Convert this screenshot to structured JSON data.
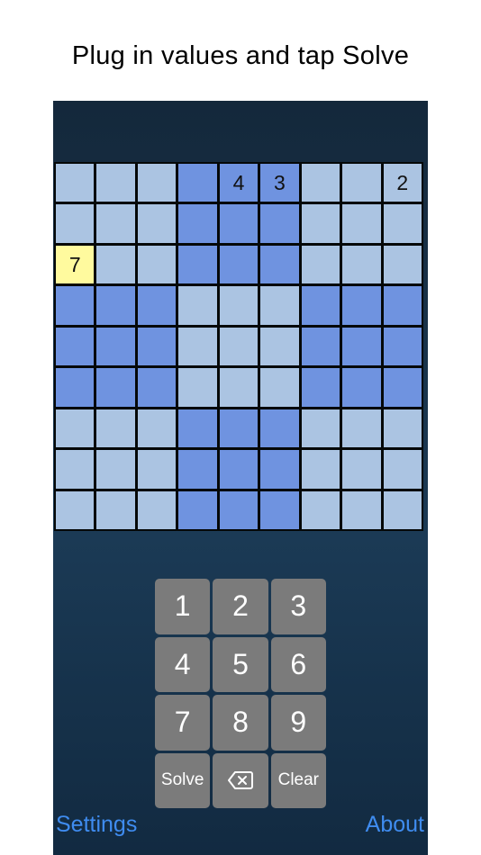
{
  "caption": "Plug in values and tap Solve",
  "grid": {
    "rows": [
      [
        "",
        "",
        "",
        "",
        "4",
        "3",
        "",
        "",
        "2"
      ],
      [
        "",
        "",
        "",
        "",
        "",
        "",
        "",
        "",
        ""
      ],
      [
        "7",
        "",
        "",
        "",
        "",
        "",
        "",
        "",
        ""
      ],
      [
        "",
        "",
        "",
        "",
        "",
        "",
        "",
        "",
        ""
      ],
      [
        "",
        "",
        "",
        "",
        "",
        "",
        "",
        "",
        ""
      ],
      [
        "",
        "",
        "",
        "",
        "",
        "",
        "",
        "",
        ""
      ],
      [
        "",
        "",
        "",
        "",
        "",
        "",
        "",
        "",
        ""
      ],
      [
        "",
        "",
        "",
        "",
        "",
        "",
        "",
        "",
        ""
      ],
      [
        "",
        "",
        "",
        "",
        "",
        "",
        "",
        "",
        ""
      ]
    ],
    "selected_cell": {
      "row": 2,
      "col": 0
    },
    "colors": {
      "light_cell": "#abc4e2",
      "dark_cell": "#6f93e0",
      "selected_cell": "#fffa9e"
    }
  },
  "keypad": {
    "keys": [
      "1",
      "2",
      "3",
      "4",
      "5",
      "6",
      "7",
      "8",
      "9"
    ],
    "solve_label": "Solve",
    "backspace_icon": "backspace-icon",
    "clear_label": "Clear"
  },
  "footer": {
    "settings_label": "Settings",
    "about_label": "About",
    "link_color": "#3f8cf0"
  }
}
